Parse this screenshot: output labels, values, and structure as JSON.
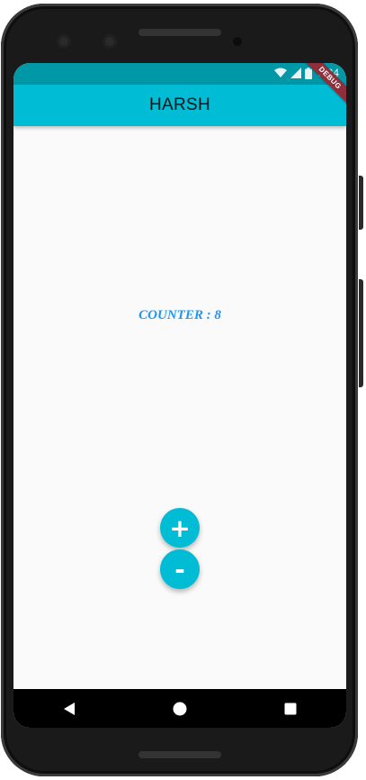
{
  "status_bar": {
    "time": "8:34",
    "icons": [
      "wifi-icon",
      "signal-icon",
      "battery-icon"
    ]
  },
  "debug_banner": "DEBUG",
  "appbar": {
    "title": "HARSH"
  },
  "counter": {
    "label": "COUNTER : 8"
  },
  "buttons": {
    "increment_label": "+",
    "decrement_label": "-"
  },
  "nav": {
    "icons": [
      "back-icon",
      "home-icon",
      "recents-icon"
    ]
  },
  "colors": {
    "appbar": "#00bcd4",
    "status_bar": "#0097a7",
    "counter_text": "#2196f3",
    "fab": "#00bcd4",
    "background": "#fafafa"
  }
}
